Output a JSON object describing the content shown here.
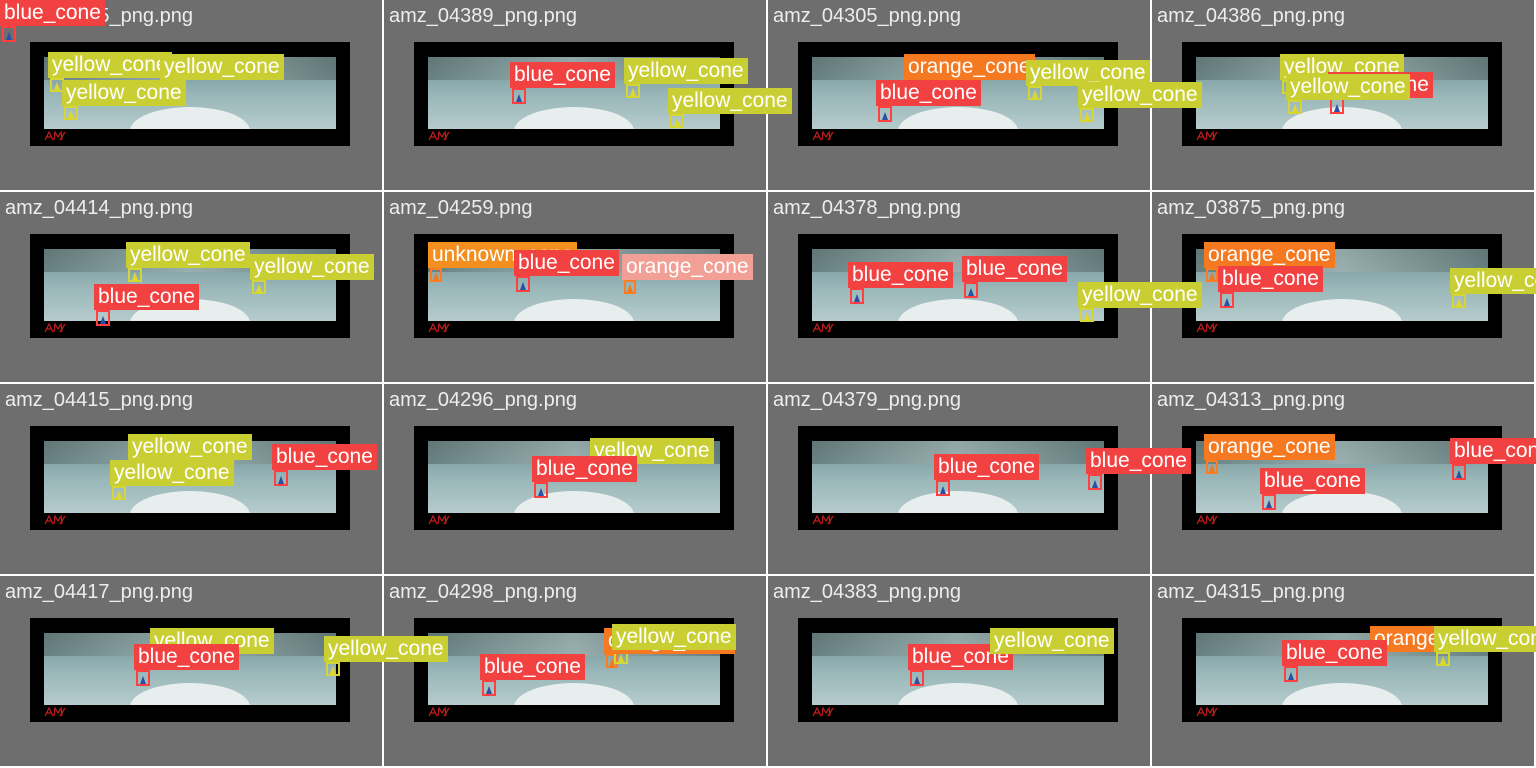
{
  "colors": {
    "blue_cone_label": "#f24141",
    "yellow_cone_label": "#c9cf32",
    "orange_cone_label": "#f57921",
    "tile_background": "#6e6e6e"
  },
  "tiles": [
    {
      "title": "amz_03835_png.png"
    },
    {
      "title": "amz_04389_png.png"
    },
    {
      "title": "amz_04305_png.png"
    },
    {
      "title": "amz_04386_png.png"
    },
    {
      "title": "amz_04414_png.png"
    },
    {
      "title": "amz_04259.png"
    },
    {
      "title": "amz_04378_png.png"
    },
    {
      "title": "amz_03875_png.png"
    },
    {
      "title": "amz_04415_png.png"
    },
    {
      "title": "amz_04296_png.png"
    },
    {
      "title": "amz_04379_png.png"
    },
    {
      "title": "amz_04313_png.png"
    },
    {
      "title": "amz_04417_png.png"
    },
    {
      "title": "amz_04298_png.png"
    },
    {
      "title": "amz_04383_png.png"
    },
    {
      "title": "amz_04315_png.png"
    }
  ],
  "labels": {
    "blue": "blue_cone",
    "yellow": "yellow_cone",
    "orange": "orange_cone",
    "unknown": "unknown_cone"
  },
  "detections": [
    {
      "tile": 0,
      "cls": "yellow",
      "text": "yellow_cone"
    },
    {
      "tile": 0,
      "cls": "yellow",
      "text": "yellow_cone"
    },
    {
      "tile": 0,
      "cls": "yellow",
      "text": "yellow_cone"
    },
    {
      "tile": 0,
      "cls": "blue",
      "text": "blue_cone"
    },
    {
      "tile": 1,
      "cls": "blue",
      "text": "blue_cone"
    },
    {
      "tile": 1,
      "cls": "yellow",
      "text": "yellow_cone"
    },
    {
      "tile": 1,
      "cls": "yellow",
      "text": "yellow_cone"
    },
    {
      "tile": 2,
      "cls": "orange",
      "text": "orange_cone"
    },
    {
      "tile": 2,
      "cls": "yellow",
      "text": "yellow_cone"
    },
    {
      "tile": 2,
      "cls": "blue",
      "text": "blue_cone"
    },
    {
      "tile": 2,
      "cls": "yellow",
      "text": "yellow_cone"
    },
    {
      "tile": 3,
      "cls": "yellow",
      "text": "yellow_cone"
    },
    {
      "tile": 3,
      "cls": "blue",
      "text": "blue_cone"
    },
    {
      "tile": 3,
      "cls": "yellow",
      "text": "yellow_cone"
    },
    {
      "tile": 4,
      "cls": "yellow",
      "text": "yellow_cone"
    },
    {
      "tile": 4,
      "cls": "yellow",
      "text": "yellow_cone"
    },
    {
      "tile": 4,
      "cls": "blue",
      "text": "blue_cone"
    },
    {
      "tile": 5,
      "cls": "unknown",
      "text": "unknown_cone"
    },
    {
      "tile": 5,
      "cls": "blue",
      "text": "blue_cone"
    },
    {
      "tile": 5,
      "cls": "pink",
      "text": "orange_cone"
    },
    {
      "tile": 6,
      "cls": "blue",
      "text": "blue_cone"
    },
    {
      "tile": 6,
      "cls": "blue",
      "text": "blue_cone"
    },
    {
      "tile": 6,
      "cls": "yellow",
      "text": "yellow_cone"
    },
    {
      "tile": 7,
      "cls": "orange",
      "text": "orange_cone"
    },
    {
      "tile": 7,
      "cls": "blue",
      "text": "blue_cone"
    },
    {
      "tile": 7,
      "cls": "yellow",
      "text": "yellow_cone"
    },
    {
      "tile": 8,
      "cls": "yellow",
      "text": "yellow_cone"
    },
    {
      "tile": 8,
      "cls": "blue",
      "text": "blue_cone"
    },
    {
      "tile": 8,
      "cls": "yellow",
      "text": "yellow_cone"
    },
    {
      "tile": 9,
      "cls": "yellow",
      "text": "yellow_cone"
    },
    {
      "tile": 9,
      "cls": "blue",
      "text": "blue_cone"
    },
    {
      "tile": 10,
      "cls": "blue",
      "text": "blue_cone"
    },
    {
      "tile": 10,
      "cls": "blue",
      "text": "blue_cone"
    },
    {
      "tile": 11,
      "cls": "orange",
      "text": "orange_cone"
    },
    {
      "tile": 11,
      "cls": "blue",
      "text": "blue_cone"
    },
    {
      "tile": 11,
      "cls": "blue",
      "text": "blue_cone"
    },
    {
      "tile": 12,
      "cls": "yellow",
      "text": "yellow_cone"
    },
    {
      "tile": 12,
      "cls": "blue",
      "text": "blue_cone"
    },
    {
      "tile": 12,
      "cls": "yellow",
      "text": "yellow_cone"
    },
    {
      "tile": 13,
      "cls": "orange",
      "text": "orange_cone"
    },
    {
      "tile": 13,
      "cls": "yellow",
      "text": "yellow_cone"
    },
    {
      "tile": 13,
      "cls": "blue",
      "text": "blue_cone"
    },
    {
      "tile": 14,
      "cls": "blue",
      "text": "blue_cone"
    },
    {
      "tile": 14,
      "cls": "yellow",
      "text": "yellow_cone"
    },
    {
      "tile": 15,
      "cls": "orange",
      "text": "orange_cone"
    },
    {
      "tile": 15,
      "cls": "yellow",
      "text": "yellow_cone"
    },
    {
      "tile": 15,
      "cls": "blue",
      "text": "blue_cone"
    }
  ]
}
